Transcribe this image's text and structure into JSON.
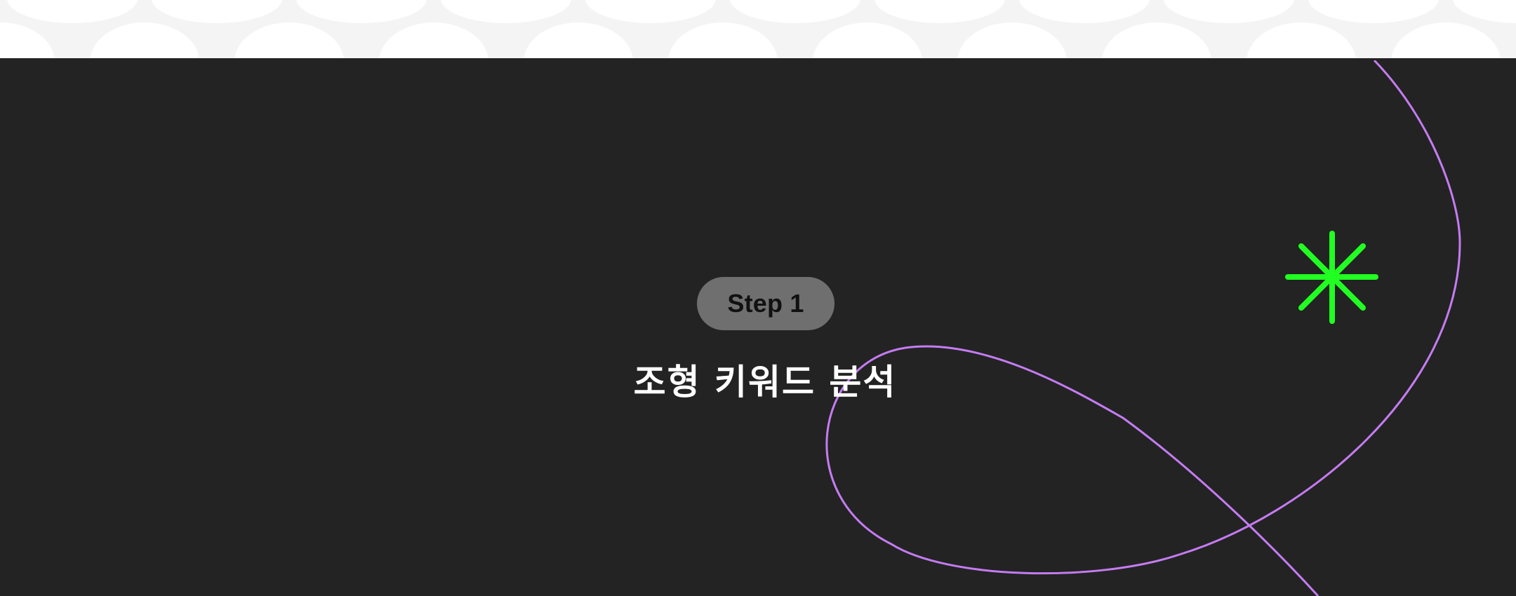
{
  "colors": {
    "pattern_light": "#f4f4f4",
    "pattern_white": "#ffffff",
    "section_background": "#232323",
    "pill_background": "#6f6f6f",
    "pill_text": "#111111",
    "title_text": "#ffffff",
    "curve_stroke": "#c57cf2",
    "asterisk_color": "#22ff22"
  },
  "step_badge": {
    "label": "Step 1"
  },
  "section": {
    "title": "조형 키워드 분석"
  },
  "decorations": {
    "asterisk_icon": "asterisk-icon",
    "curve": "loop-curve"
  }
}
